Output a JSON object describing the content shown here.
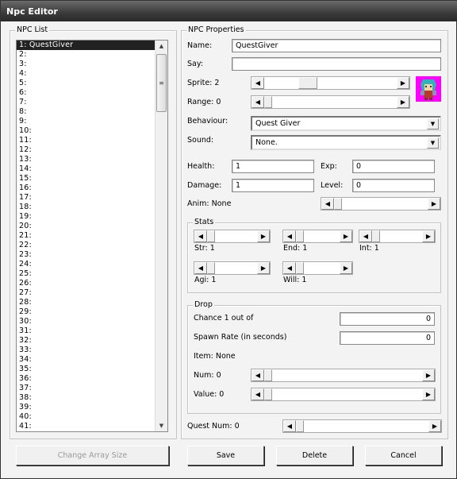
{
  "window": {
    "title": "Npc Editor"
  },
  "npc_list": {
    "label": "NPC List",
    "items": [
      "1: QuestGiver",
      "2:",
      "3:",
      "4:",
      "5:",
      "6:",
      "7:",
      "8:",
      "9:",
      "10:",
      "11:",
      "12:",
      "13:",
      "14:",
      "15:",
      "16:",
      "17:",
      "18:",
      "19:",
      "20:",
      "21:",
      "22:",
      "23:",
      "24:",
      "25:",
      "26:",
      "27:",
      "28:",
      "29:",
      "30:",
      "31:",
      "32:",
      "33:",
      "34:",
      "35:",
      "36:",
      "37:",
      "38:",
      "39:",
      "40:",
      "41:"
    ],
    "selected_index": 0
  },
  "props": {
    "label": "NPC Properties",
    "name_label": "Name:",
    "name_value": "QuestGiver",
    "say_label": "Say:",
    "say_value": "",
    "sprite_label": "Sprite: 2",
    "sprite_level": 0.3,
    "range_label": "Range: 0",
    "range_level": 0,
    "behaviour_label": "Behaviour:",
    "behaviour_value": "Quest Giver",
    "sound_label": "Sound:",
    "sound_value": "None.",
    "health_label": "Health:",
    "health_value": "1",
    "exp_label": "Exp:",
    "exp_value": "0",
    "damage_label": "Damage:",
    "damage_value": "1",
    "level_label": "Level:",
    "level_value": "0",
    "anim_label": "Anim: None",
    "anim_level": 0
  },
  "stats": {
    "label": "Stats",
    "str": "Str: 1",
    "end": "End: 1",
    "int": "Int: 1",
    "agi": "Agi: 1",
    "will": "Will: 1"
  },
  "drop": {
    "label": "Drop",
    "chance_label": "Chance 1 out of",
    "chance_value": "0",
    "spawn_label": "Spawn Rate (in seconds)",
    "spawn_value": "0",
    "item_label": "Item: None",
    "num_label": "Num: 0",
    "value_label": "Value: 0"
  },
  "quest": {
    "label": "Quest Num: 0"
  },
  "buttons": {
    "change_array": "Change Array Size",
    "save": "Save",
    "delete": "Delete",
    "cancel": "Cancel"
  },
  "colors": {
    "sprite_bg": "#ff00ff",
    "selection": "#222222"
  }
}
